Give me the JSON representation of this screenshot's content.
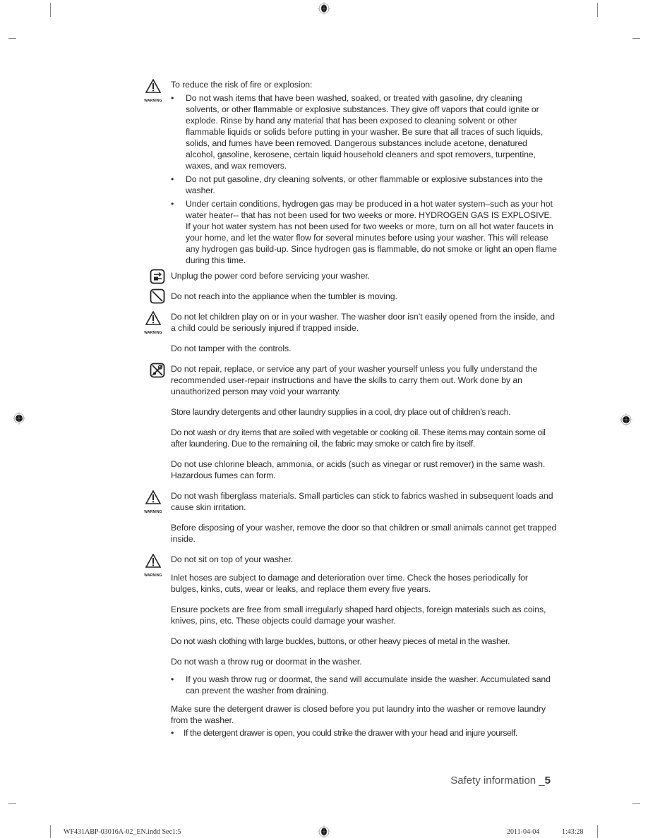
{
  "page": {
    "footer": {
      "section_title": "Safety information _",
      "page_number": "5"
    },
    "slug": {
      "file": "WF431ABP-03016A-02_EN.indd   Sec1:5",
      "date": "2011-04-04",
      "time": "1:43:28"
    }
  },
  "icons": {
    "warning_label": "WARNING"
  },
  "sections": {
    "fire": {
      "intro": "To reduce the risk of fire or explosion:",
      "bullets": [
        "Do not wash items that have been washed, soaked, or treated with gasoline, dry cleaning solvents, or other flammable or explosive substances. They give off vapors that could ignite or explode. Rinse by hand any material that has been exposed to cleaning solvent or other flammable liquids or solids before putting in your washer. Be sure that all traces of such liquids, solids, and fumes have been removed. Dangerous substances include acetone, denatured alcohol, gasoline, kerosene, certain liquid household cleaners and spot removers, turpentine, waxes, and wax removers.",
        "Do not put gasoline, dry cleaning solvents, or other flammable or explosive substances into the washer.",
        "Under certain conditions, hydrogen gas may be produced in a hot water system–such as your hot water heater-- that has not been used for two weeks or more. HYDROGEN GAS IS EXPLOSIVE. If your hot water system has not been used for two weeks or more, turn on all hot water faucets in your home, and let the water flow for several minutes before using your washer. This will release any hydrogen gas build-up. Since hydrogen gas is flammable, do not smoke or light an open flame during this time."
      ]
    },
    "unplug": "Unplug the power cord before servicing your washer.",
    "reach": "Do not reach into the appliance when the tumbler is moving.",
    "children": "Do not let children play on or in your washer. The washer door isn’t easily opened from the inside, and a child could be seriously injured if trapped inside.",
    "tamper": "Do not tamper with the controls.",
    "repair": "Do not repair, replace, or service any part of your washer yourself unless you fully understand the recommended user-repair instructions and have the skills to carry them out. Work done by an unauthorized person may void your warranty.",
    "store": "Store laundry detergents and other laundry supplies in a cool, dry place out of children’s reach.",
    "oil": "Do not wash or dry items that are soiled with vegetable or cooking oil. These items may contain some oil after laundering. Due to the remaining oil, the fabric may smoke or catch fire by itself.",
    "chlorine": "Do not use chlorine bleach, ammonia, or acids (such as vinegar or rust remover) in the same wash. Hazardous fumes can form.",
    "fiberglass": "Do not wash fiberglass materials. Small particles can stick to fabrics washed in subsequent loads and cause skin irritation.",
    "disposing": "Before disposing of your washer, remove the door so that children or small animals cannot get trapped inside.",
    "sit": "Do not sit on top of your washer.",
    "hoses": "Inlet hoses are subject to damage and deterioration over time. Check the hoses periodically for bulges, kinks, cuts, wear or leaks, and replace them every five years.",
    "pockets": "Ensure pockets are free from small irregularly shaped hard objects, foreign materials such as coins, knives, pins, etc. These objects could damage your washer.",
    "buckles": "Do not wash clothing with large buckles, buttons, or other heavy pieces of metal in the washer.",
    "rug": {
      "text": "Do not wash a throw rug or doormat in the washer.",
      "bullets": [
        "If you wash throw rug or doormat, the sand will accumulate inside the washer. Accumulated sand can prevent the washer from draining."
      ]
    },
    "drawer": {
      "text": "Make sure the detergent drawer is closed before you put laundry into the washer or remove laundry from the washer.",
      "bullets": [
        "If the detergent drawer is open, you could strike the drawer with your head and injure yourself."
      ]
    }
  }
}
